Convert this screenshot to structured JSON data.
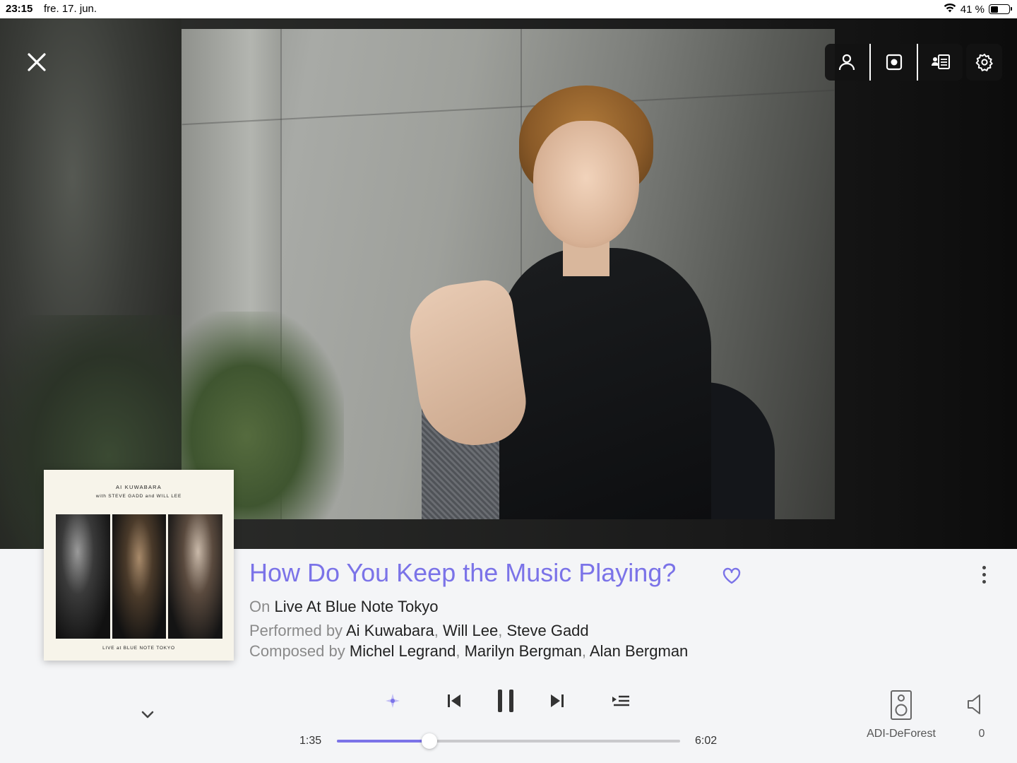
{
  "status_bar": {
    "time": "23:15",
    "date": "fre. 17. jun.",
    "battery_text": "41 %",
    "battery_level": 0.41
  },
  "icons": {
    "close": "close-icon",
    "artist": "person-icon",
    "album": "album-icon",
    "credits": "credits-icon",
    "settings": "gear-icon",
    "favorite": "heart-icon",
    "more": "more-vertical-icon",
    "collapse": "chevron-down-icon",
    "radio": "radio-sparkle-icon",
    "previous": "skip-previous-icon",
    "pause": "pause-icon",
    "next": "skip-next-icon",
    "queue": "queue-icon",
    "zone": "speaker-icon",
    "volume": "volume-icon"
  },
  "album_cover": {
    "artist": "AI KUWABARA",
    "with_prefix": "with",
    "with_artists_1": "STEVE GADD",
    "with_and": "and",
    "with_artists_2": "WILL LEE",
    "footer_live": "LIVE",
    "footer_at": "at",
    "footer_venue": "BLUE NOTE TOKYO"
  },
  "track": {
    "title": "How Do You Keep the Music Playing?",
    "on_label": "On",
    "album": "Live At Blue Note Tokyo",
    "performed_label": "Performed by",
    "performers": [
      "Ai Kuwabara",
      "Will Lee",
      "Steve Gadd"
    ],
    "composed_label": "Composed by",
    "composers": [
      "Michel Legrand",
      "Marilyn Bergman",
      "Alan Bergman"
    ]
  },
  "playback": {
    "current_time": "1:35",
    "total_time": "6:02",
    "progress": 0.27
  },
  "zone": {
    "name": "ADI-DeForest",
    "volume": "0"
  },
  "colors": {
    "accent": "#7b73e8",
    "toolbar_bg": "#121212",
    "panel_bg": "#f4f5f7"
  }
}
